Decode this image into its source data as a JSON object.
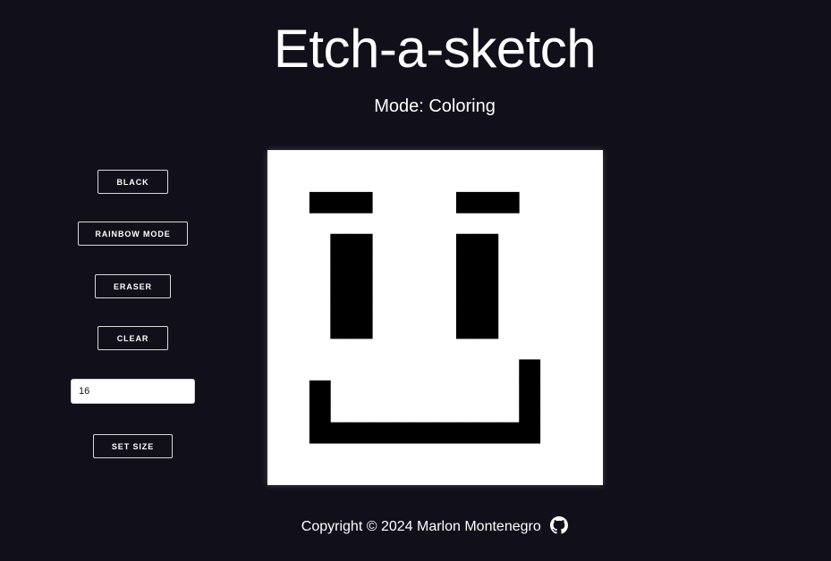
{
  "header": {
    "title": "Etch-a-sketch",
    "mode_line": "Mode: Coloring"
  },
  "controls": {
    "black_label": "BLACK",
    "rainbow_label": "RAINBOW MODE",
    "eraser_label": "ERASER",
    "clear_label": "CLEAR",
    "size_value": "16",
    "set_size_label": "SET SIZE"
  },
  "board": {
    "grid_size": 16,
    "background_color": "#ffffff",
    "ink_color": "#000000",
    "filled_cells": [
      [
        2,
        2
      ],
      [
        3,
        2
      ],
      [
        4,
        2
      ],
      [
        9,
        2
      ],
      [
        10,
        2
      ],
      [
        11,
        2
      ],
      [
        3,
        4
      ],
      [
        4,
        4
      ],
      [
        9,
        4
      ],
      [
        10,
        4
      ],
      [
        3,
        5
      ],
      [
        4,
        5
      ],
      [
        9,
        5
      ],
      [
        10,
        5
      ],
      [
        3,
        6
      ],
      [
        4,
        6
      ],
      [
        9,
        6
      ],
      [
        10,
        6
      ],
      [
        3,
        7
      ],
      [
        4,
        7
      ],
      [
        9,
        7
      ],
      [
        10,
        7
      ],
      [
        3,
        8
      ],
      [
        4,
        8
      ],
      [
        9,
        8
      ],
      [
        10,
        8
      ],
      [
        12,
        10
      ],
      [
        2,
        11
      ],
      [
        12,
        11
      ],
      [
        2,
        12
      ],
      [
        12,
        12
      ],
      [
        2,
        13
      ],
      [
        3,
        13
      ],
      [
        4,
        13
      ],
      [
        5,
        13
      ],
      [
        6,
        13
      ],
      [
        7,
        13
      ],
      [
        8,
        13
      ],
      [
        9,
        13
      ],
      [
        10,
        13
      ],
      [
        11,
        13
      ],
      [
        12,
        13
      ]
    ]
  },
  "footer": {
    "copyright": "Copyright © 2024 Marlon Montenegro",
    "github_icon": "github-icon"
  },
  "colors": {
    "page_background": "#11101a",
    "text": "#ffffff",
    "button_border": "#d9d9d9"
  }
}
